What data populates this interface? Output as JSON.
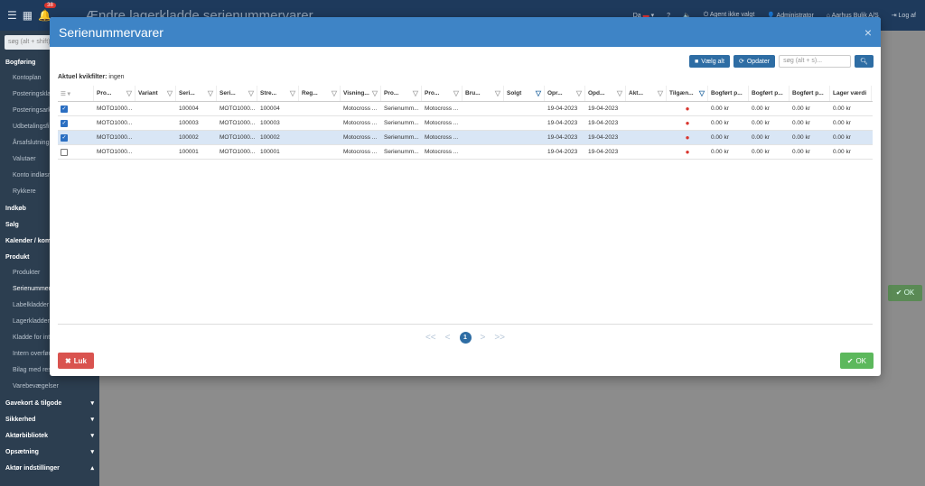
{
  "topbar": {
    "badge": "38",
    "title": "Ændre lagerkladde serienummervarer",
    "lang": "Da",
    "help": "?",
    "agent": "Agent ikke valgt",
    "user": "Administrator",
    "company": "Aarhus Bulik A/S",
    "logout": "Log af"
  },
  "sidebar": {
    "search": "søg (alt + shift)",
    "sections": [
      {
        "label": "Bogføring",
        "items": [
          "Kontoplan",
          "Posteringskladder",
          "Posteringsarkiv",
          "Udbetalingsfil",
          "Årsafslutning",
          "Valutaer",
          "Konto indløsning",
          "Rykkere"
        ]
      },
      {
        "label": "Indkøb",
        "items": []
      },
      {
        "label": "Salg",
        "items": []
      },
      {
        "label": "Kalender / kommunikation",
        "items": []
      },
      {
        "label": "Produkt",
        "items": [
          "Produkter",
          "Serienummervarer",
          "Labelkladder",
          "Lagerkladder",
          "Kladde for intern",
          "Intern overførsel",
          "Bilag med reservation",
          "Varebevægelser"
        ]
      },
      {
        "label": "Gavekort & tilgode",
        "items": []
      },
      {
        "label": "Sikkerhed",
        "items": []
      },
      {
        "label": "Aktørbibliotek",
        "items": []
      },
      {
        "label": "Opsætning",
        "items": []
      },
      {
        "label": "Aktør indstillinger",
        "items": []
      }
    ]
  },
  "background": {
    "ok_label": "OK"
  },
  "modal": {
    "title": "Serienummervarer",
    "close": "×",
    "select_all": "Vælg alt",
    "refresh": "Opdater",
    "search_placeholder": "søg (alt + s)...",
    "filter_label": "Aktuel kvikfilter:",
    "filter_value": "ingen",
    "columns": [
      "Pro...",
      "Variant",
      "Seri...",
      "Seri...",
      "Stre...",
      "Reg...",
      "Visning...",
      "Pro...",
      "Pro...",
      "Bru...",
      "Solgt",
      "Opr...",
      "Opd...",
      "Akt...",
      "Tilgæn...",
      "Bogført p...",
      "Bogført p...",
      "Bogført p...",
      "Lager værdi"
    ],
    "rows": [
      {
        "checked": true,
        "cells": [
          "MOTO1000...",
          "",
          "100004",
          "MOTO1000...",
          "100004",
          "",
          "Motocross ...",
          "Serienumm...",
          "Motocross ...",
          "",
          "",
          "19-04-2023",
          "19-04-2023",
          "",
          "●",
          "0.00 kr",
          "0.00 kr",
          "0.00 kr",
          "0.00 kr"
        ]
      },
      {
        "checked": true,
        "cells": [
          "MOTO1000...",
          "",
          "100003",
          "MOTO1000...",
          "100003",
          "",
          "Motocross ...",
          "Serienumm...",
          "Motocross ...",
          "",
          "",
          "19-04-2023",
          "19-04-2023",
          "",
          "●",
          "0.00 kr",
          "0.00 kr",
          "0.00 kr",
          "0.00 kr"
        ]
      },
      {
        "checked": true,
        "cells": [
          "MOTO1000...",
          "",
          "100002",
          "MOTO1000...",
          "100002",
          "",
          "Motocross ...",
          "Serienumm...",
          "Motocross ...",
          "",
          "",
          "19-04-2023",
          "19-04-2023",
          "",
          "●",
          "0.00 kr",
          "0.00 kr",
          "0.00 kr",
          "0.00 kr"
        ]
      },
      {
        "checked": false,
        "cells": [
          "MOTO1000...",
          "",
          "100001",
          "MOTO1000...",
          "100001",
          "",
          "Motocross ...",
          "Serienumm...",
          "Motocross ...",
          "",
          "",
          "19-04-2023",
          "19-04-2023",
          "",
          "●",
          "0.00 kr",
          "0.00 kr",
          "0.00 kr",
          "0.00 kr"
        ]
      }
    ],
    "pager": {
      "first": "<<",
      "prev": "<",
      "page": "1",
      "next": ">",
      "last": ">>"
    },
    "close_label": "Luk",
    "ok_label": "OK"
  }
}
